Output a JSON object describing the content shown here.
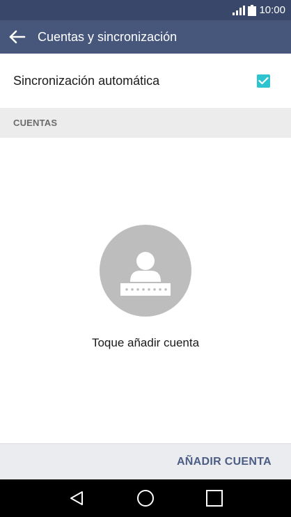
{
  "status_bar": {
    "time": "10:00",
    "icons": [
      "signal-icon",
      "battery-icon"
    ]
  },
  "toolbar": {
    "back_icon": "arrow-left-icon",
    "title": "Cuentas y sincronización"
  },
  "sync": {
    "label": "Sincronización automática",
    "checked": true
  },
  "section": {
    "header": "CUENTAS"
  },
  "empty_state": {
    "icon": "account-avatar-icon",
    "text": "Toque añadir cuenta"
  },
  "footer": {
    "add_account_label": "AÑADIR CUENTA"
  },
  "nav": {
    "back_icon": "triangle-back-icon",
    "home_icon": "circle-home-icon",
    "recents_icon": "square-recents-icon"
  },
  "colors": {
    "status_bar": "#39486a",
    "toolbar": "#47577c",
    "accent": "#2dc3cf",
    "footer_text": "#4c5d85"
  }
}
